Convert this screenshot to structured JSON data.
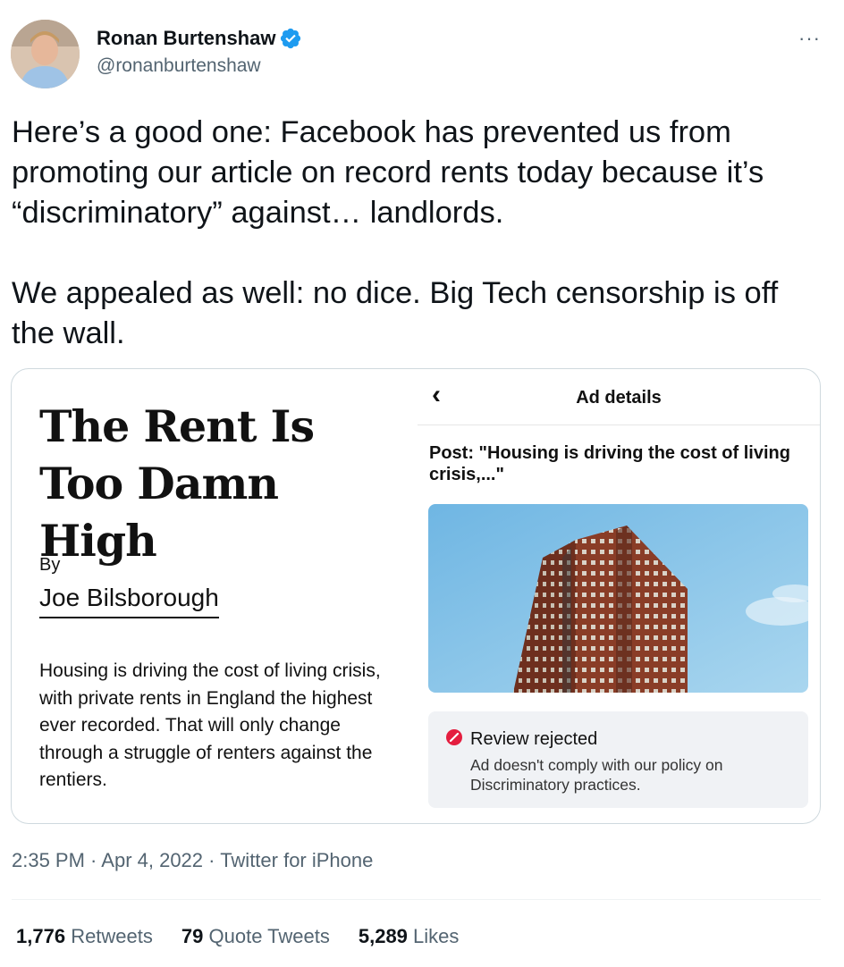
{
  "author": {
    "display_name": "Ronan Burtenshaw",
    "handle": "@ronanburtenshaw",
    "verified": true
  },
  "more_icon": "···",
  "tweet_text": {
    "paragraph1": "Here’s a good one: Facebook has prevented us from promoting our article on record rents today because it’s “discriminatory” against… landlords.",
    "paragraph2": "We appealed as well: no dice. Big Tech censorship is off the wall."
  },
  "article": {
    "title": "The Rent Is Too Damn High",
    "by": "By",
    "author": "Joe Bilsborough",
    "excerpt": "Housing is driving the cost of living crisis, with private rents in England the highest ever recorded. That will only change through a struggle of renters against the rentiers."
  },
  "ad_details": {
    "back_icon": "‹",
    "title": "Ad details",
    "post_line": "Post: \"Housing is driving the cost of living crisis,...\"",
    "review_title": "Review rejected",
    "review_text": "Ad doesn't comply with our policy on Discriminatory practices."
  },
  "meta": {
    "time": "2:35 PM",
    "sep1": " · ",
    "date": "Apr 4, 2022",
    "sep2": " · ",
    "source": "Twitter for iPhone"
  },
  "stats": {
    "retweets_count": "1,776",
    "retweets_label": "Retweets",
    "quotes_count": "79",
    "quotes_label": "Quote Tweets",
    "likes_count": "5,289",
    "likes_label": "Likes"
  },
  "colors": {
    "verified_blue": "#1d9bf0",
    "secondary_text": "#536471",
    "reject_red": "#e41e3f",
    "sky": "#7ec0e6"
  }
}
